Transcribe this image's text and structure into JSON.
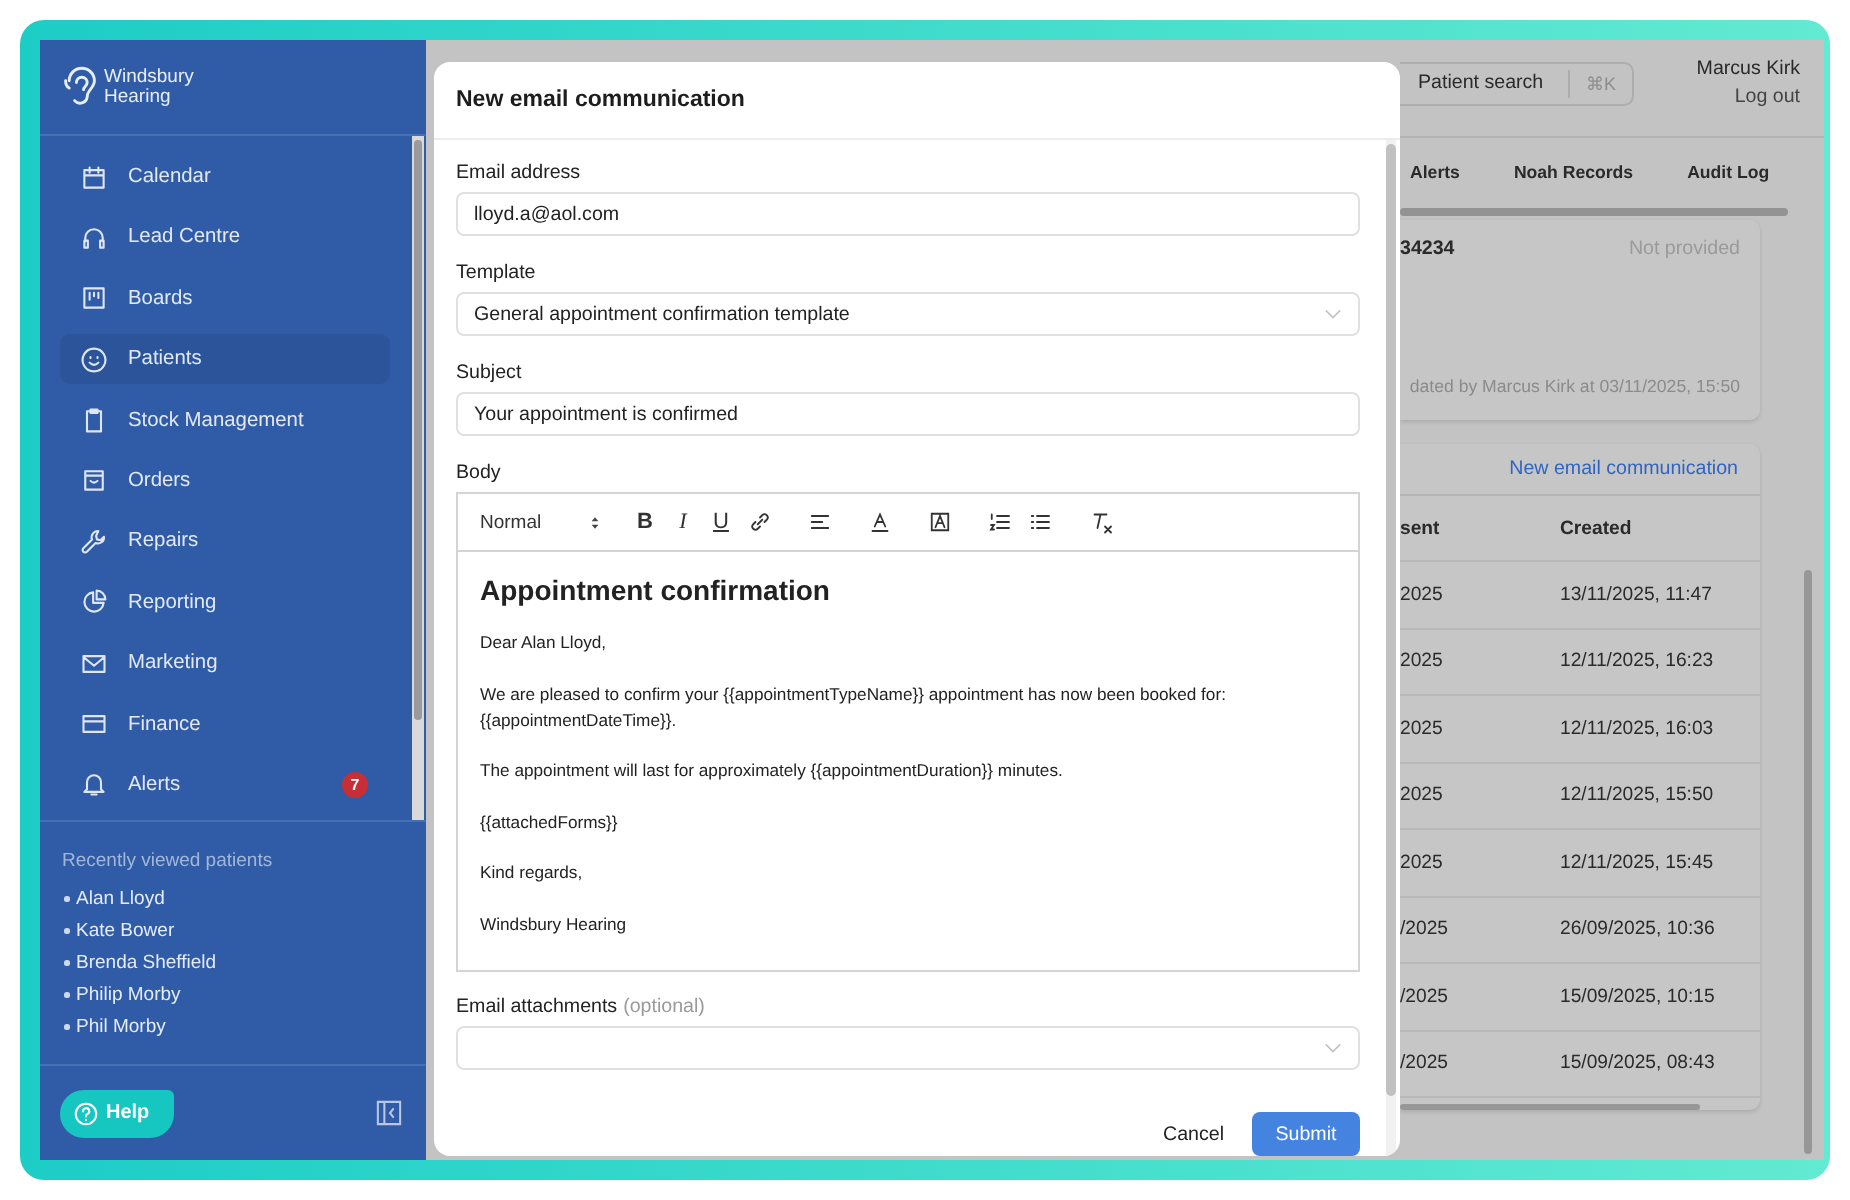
{
  "sidebar": {
    "brand": "Windsbury Hearing",
    "nav": [
      {
        "label": "Calendar",
        "selected": false
      },
      {
        "label": "Lead Centre",
        "selected": false
      },
      {
        "label": "Boards",
        "selected": false
      },
      {
        "label": "Patients",
        "selected": true
      },
      {
        "label": "Stock Management",
        "selected": false
      },
      {
        "label": "Orders",
        "selected": false
      },
      {
        "label": "Repairs",
        "selected": false
      },
      {
        "label": "Reporting",
        "selected": false
      },
      {
        "label": "Marketing",
        "selected": false
      },
      {
        "label": "Finance",
        "selected": false
      },
      {
        "label": "Alerts",
        "selected": false,
        "badge": "7"
      }
    ],
    "recent_title": "Recently viewed patients",
    "recent": [
      "Alan Lloyd",
      "Kate Bower",
      "Brenda Sheffield",
      "Philip Morby",
      "Phil Morby"
    ],
    "help": "Help"
  },
  "header": {
    "search_placeholder": "Patient search",
    "shortcut": "⌘K",
    "user": "Marcus Kirk",
    "logout": "Log out"
  },
  "tabs": [
    "Alerts",
    "Noah Records",
    "Audit Log"
  ],
  "details_card": {
    "value": "34234",
    "status": "Not provided",
    "updated": "dated by Marcus Kirk at 03/11/2025, 15:50"
  },
  "communications": {
    "link": "New email communication",
    "columns": [
      "sent",
      "Created"
    ],
    "rows": [
      [
        "2025",
        "13/11/2025, 11:47"
      ],
      [
        "2025",
        "12/11/2025, 16:23"
      ],
      [
        "2025",
        "12/11/2025, 16:03"
      ],
      [
        "2025",
        "12/11/2025, 15:50"
      ],
      [
        "2025",
        "12/11/2025, 15:45"
      ],
      [
        "/2025",
        "26/09/2025, 10:36"
      ],
      [
        "/2025",
        "15/09/2025, 10:15"
      ],
      [
        "/2025",
        "15/09/2025, 08:43"
      ]
    ]
  },
  "modal": {
    "title": "New email communication",
    "email_label": "Email address",
    "email": "lloyd.a@aol.com",
    "template_label": "Template",
    "template": "General appointment confirmation template",
    "subject_label": "Subject",
    "subject": "Your appointment is confirmed",
    "body_label": "Body",
    "toolbar": {
      "format": "Normal",
      "buttons": [
        {
          "kind": "bold",
          "label": "B"
        },
        {
          "kind": "italic",
          "label": "I"
        },
        {
          "kind": "underline",
          "label": "U"
        },
        {
          "kind": "link"
        },
        {
          "kind": "align"
        },
        {
          "kind": "text-color"
        },
        {
          "kind": "highlight"
        },
        {
          "kind": "ordered-list"
        },
        {
          "kind": "bullet-list"
        },
        {
          "kind": "clear-format"
        }
      ]
    },
    "body_heading": "Appointment confirmation",
    "body_paragraphs": [
      "Dear Alan Lloyd,",
      "We are pleased to confirm your {{appointmentTypeName}} appointment has now been booked for: {{appointmentDateTime}}.",
      "The appointment will last for approximately {{appointmentDuration}} minutes.",
      "{{attachedForms}}",
      "Kind regards,",
      "Windsbury Hearing"
    ],
    "attachments_label": "Email attachments",
    "attachments_hint": "(optional)",
    "cancel": "Cancel",
    "submit": "Submit"
  }
}
